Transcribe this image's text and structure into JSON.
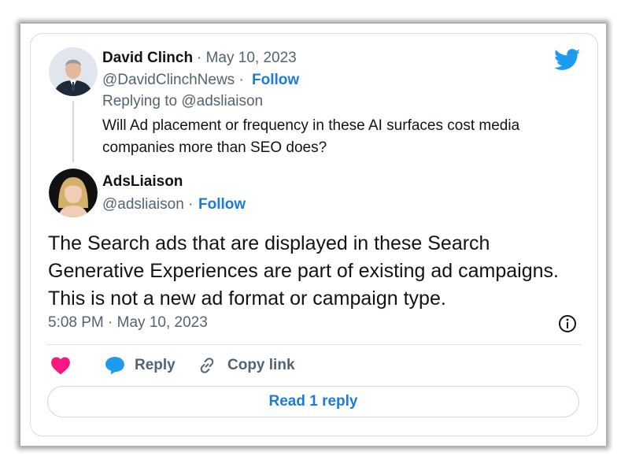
{
  "reply_tweet": {
    "author_name": "David Clinch",
    "date": "· May 10, 2023",
    "handle": "@DavidClinchNews ·",
    "follow_label": "Follow",
    "replying_to": "Replying to @adsliaison",
    "text_line1": "Will Ad placement or frequency in these AI surfaces cost media",
    "text_line2": "companies more than SEO does?"
  },
  "main_tweet": {
    "author_name": "AdsLiaison",
    "handle": "@adsliaison ·",
    "follow_label": "Follow",
    "text_line1": "The Search ads that are displayed in these Search",
    "text_line2": "Generative Experiences are part of existing ad campaigns.",
    "text_line3": "This is not a new ad format or campaign type.",
    "timestamp": "5:08 PM · May 10, 2023"
  },
  "actions": {
    "reply_label": "Reply",
    "copy_link_label": "Copy link",
    "read_replies_label": "Read 1 reply"
  },
  "icons": {
    "brand": "twitter-bird-icon",
    "info": "info-icon",
    "like": "heart-icon",
    "reply": "speech-bubble-icon",
    "link": "chain-link-icon"
  },
  "colors": {
    "twitter_blue": "#1d9bf0",
    "link_blue": "#1d7bd8",
    "heart_pink": "#f91880",
    "text_dark": "#0f1419",
    "text_grey": "#536471"
  }
}
